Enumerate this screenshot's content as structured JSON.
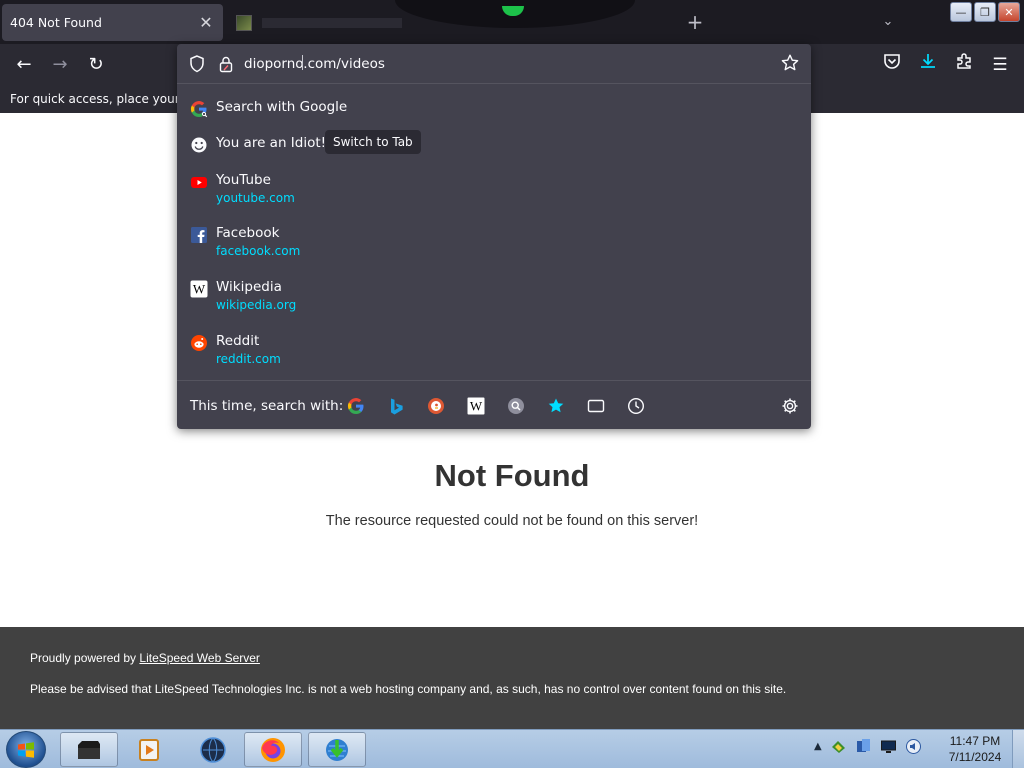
{
  "browser": {
    "tabs": [
      {
        "title": "404 Not Found",
        "active": true,
        "close_label": "✕"
      },
      {
        "title": "",
        "active": false
      }
    ],
    "new_tab_label": "+",
    "tab_list_label": "⌄"
  },
  "window_controls": {
    "minimize": "—",
    "restore": "❐",
    "close": "✕"
  },
  "navbar": {
    "back": "←",
    "forward": "→",
    "reload": "↻",
    "menu": "☰"
  },
  "bookmarks_bar": {
    "text": "For quick access, place your boo"
  },
  "urlbar": {
    "value": "dioporno.com/videos",
    "suggestions": [
      {
        "title": "Search with Google",
        "url": "",
        "icon": "google-icon"
      },
      {
        "title": "You are an Idiot!",
        "url": "",
        "icon": "smiley-icon",
        "action": "Switch to Tab"
      },
      {
        "title": "YouTube",
        "url": "youtube.com",
        "icon": "youtube-icon"
      },
      {
        "title": "Facebook",
        "url": "facebook.com",
        "icon": "facebook-icon"
      },
      {
        "title": "Wikipedia",
        "url": "wikipedia.org",
        "icon": "wikipedia-icon"
      },
      {
        "title": "Reddit",
        "url": "reddit.com",
        "icon": "reddit-icon"
      }
    ],
    "one_off_label": "This time, search with:",
    "one_off_engines": [
      "google-icon",
      "bing-icon",
      "duckduckgo-icon",
      "wikipedia-icon",
      "search-icon",
      "bookmarks-star-icon",
      "tabs-icon",
      "history-icon"
    ]
  },
  "page": {
    "heading": "Not Found",
    "message": "The resource requested could not be found on this server!",
    "footer_prefix": "Proudly powered by ",
    "footer_link": "LiteSpeed Web Server",
    "footer_notice": "Please be advised that LiteSpeed Technologies Inc. is not a web hosting company and, as such, has no control over content found on this site."
  },
  "taskbar": {
    "items": [
      "start-button",
      "folder-icon",
      "media-player-icon",
      "globe-icon",
      "firefox-icon",
      "internet-download-manager-icon"
    ],
    "clock_time": "11:47 PM",
    "clock_date": "7/11/2024"
  },
  "colors": {
    "accent": "#00ddff",
    "panel_bg": "#42414d",
    "toolbar_bg": "#2b2a33",
    "footer_bg": "#414141"
  }
}
